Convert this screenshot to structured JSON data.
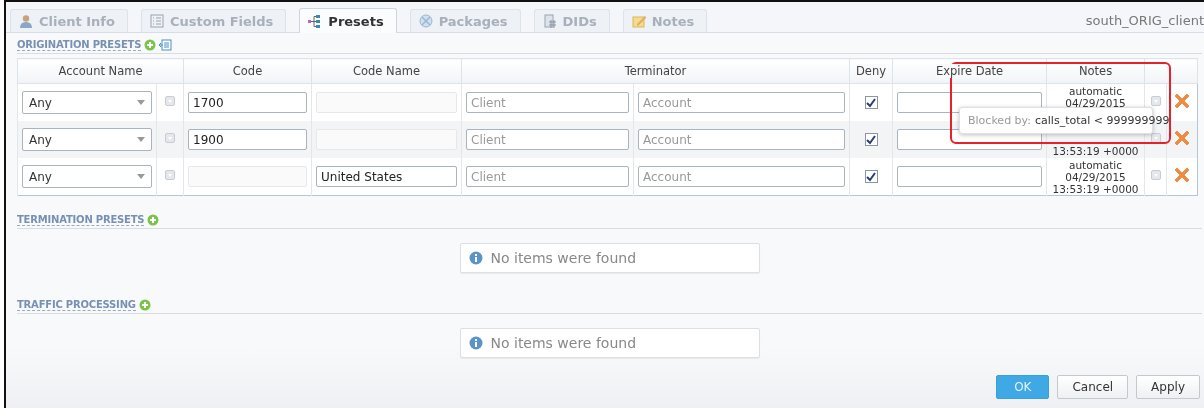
{
  "tabs": [
    {
      "label": "Client Info",
      "selected": false
    },
    {
      "label": "Custom Fields",
      "selected": false
    },
    {
      "label": "Presets",
      "selected": true
    },
    {
      "label": "Packages",
      "selected": false
    },
    {
      "label": "DIDs",
      "selected": false
    },
    {
      "label": "Notes",
      "selected": false
    }
  ],
  "client_name": "south_ORIG_client",
  "sections": [
    {
      "title": "ORIGINATION PRESETS",
      "table": {
        "columns": [
          "Account Name",
          "Code",
          "Code Name",
          "Terminator",
          "Deny",
          "Expire Date",
          "Notes"
        ],
        "rows": [
          {
            "account": "Any",
            "code": {
              "value": "1700",
              "disabled": false
            },
            "code_name": {
              "disabled": true
            },
            "client": {
              "placeholder": "Client"
            },
            "terminator_account": {
              "placeholder": "Account"
            },
            "deny": true,
            "notes": [
              "automatic",
              "04/29/2015"
            ]
          },
          {
            "account": "Any",
            "code": {
              "value": "1900",
              "disabled": false
            },
            "code_name": {
              "disabled": true
            },
            "client": {
              "placeholder": "Client"
            },
            "terminator_account": {
              "placeholder": "Account"
            },
            "deny": true,
            "notes": [
              "13:53:19 +0000"
            ]
          },
          {
            "account": "Any",
            "code": {
              "disabled": true
            },
            "code_name": {
              "value": "United States",
              "disabled": false
            },
            "client": {
              "placeholder": "Client"
            },
            "terminator_account": {
              "placeholder": "Account"
            },
            "deny": true,
            "notes": [
              "automatic",
              "04/29/2015",
              "13:53:19 +0000"
            ]
          }
        ]
      },
      "tooltip": {
        "label": "Blocked by:",
        "value": "calls_total < 999999999"
      }
    },
    {
      "title": "TERMINATION PRESETS",
      "empty_message": "No items were found"
    },
    {
      "title": "TRAFFIC PROCESSING",
      "empty_message": "No items were found"
    }
  ],
  "buttons": [
    {
      "label": "OK",
      "kind": "primary"
    },
    {
      "label": "Cancel",
      "kind": "default"
    },
    {
      "label": "Apply",
      "kind": "default"
    }
  ]
}
